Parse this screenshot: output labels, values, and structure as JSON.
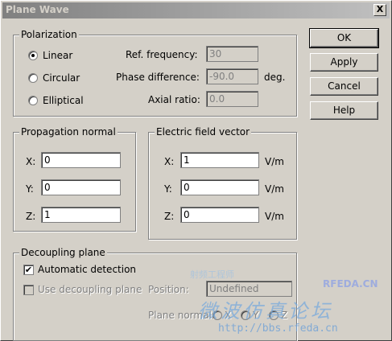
{
  "window": {
    "title": "Plane Wave",
    "close_glyph": "X"
  },
  "buttons": {
    "ok": "OK",
    "apply": "Apply",
    "cancel": "Cancel",
    "help": "Help"
  },
  "polarization": {
    "group_label": "Polarization",
    "options": [
      "Linear",
      "Circular",
      "Elliptical"
    ],
    "selected": "Linear",
    "ref_frequency_label": "Ref. frequency:",
    "ref_frequency_value": "30",
    "phase_difference_label": "Phase difference:",
    "phase_difference_value": "-90.0",
    "phase_unit": "deg.",
    "axial_ratio_label": "Axial ratio:",
    "axial_ratio_value": "0.0"
  },
  "propagation_normal": {
    "group_label": "Propagation normal",
    "x_label": "X:",
    "x_value": "0",
    "y_label": "Y:",
    "y_value": "0",
    "z_label": "Z:",
    "z_value": "1"
  },
  "electric_field": {
    "group_label": "Electric field vector",
    "x_label": "X:",
    "x_value": "1",
    "y_label": "Y:",
    "y_value": "0",
    "z_label": "Z:",
    "z_value": "0",
    "unit": "V/m"
  },
  "decoupling": {
    "group_label": "Decoupling plane",
    "automatic_detection_label": "Automatic detection",
    "automatic_detection_checked": true,
    "use_plane_label": "Use decoupling plane",
    "use_plane_checked": false,
    "position_label": "Position:",
    "position_value": "Undefined",
    "plane_normal_label": "Plane normal:",
    "plane_normal_options": [
      "X",
      "Y",
      "Z"
    ]
  },
  "watermark": {
    "top_text": "射频工程师",
    "brand": "RFEDA.CN",
    "chinese_text": "微波仿真论坛",
    "url": "http://bbs.rfeda.cn"
  }
}
